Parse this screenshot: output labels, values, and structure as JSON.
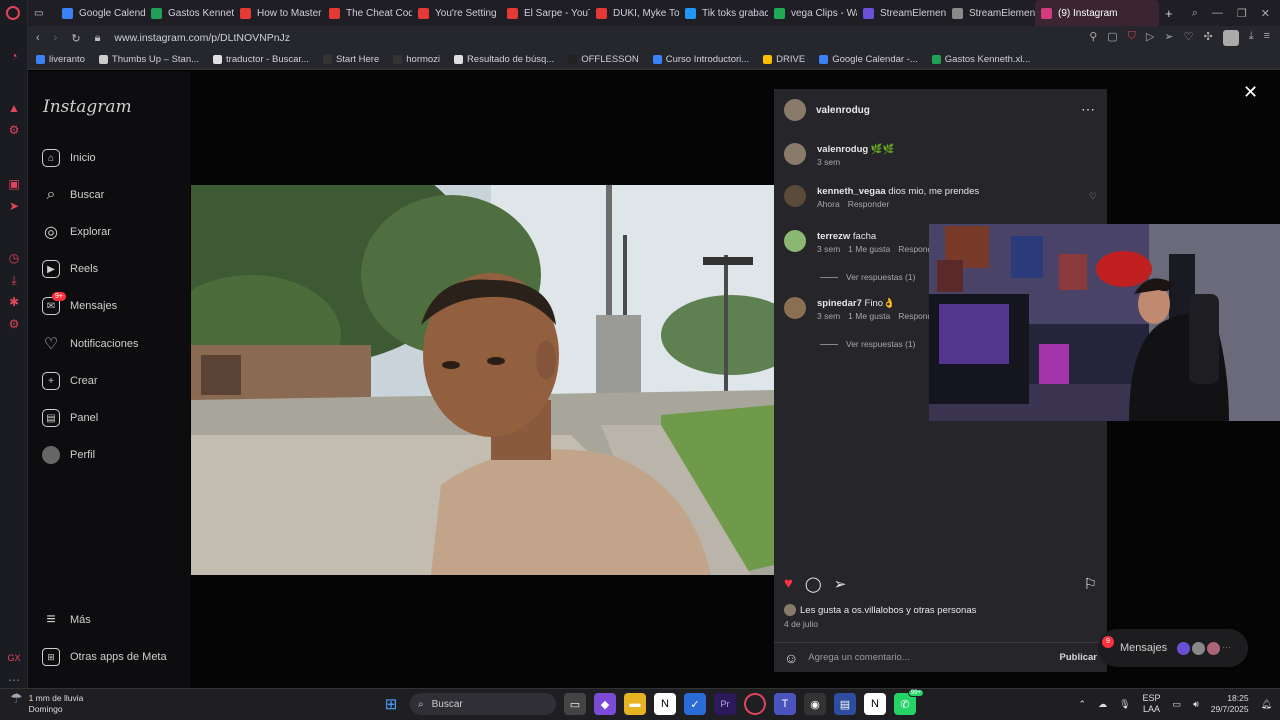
{
  "browser": {
    "tabs": [
      {
        "label": "Google Calenda",
        "color": "#3b82f6"
      },
      {
        "label": "Gastos Kenneth",
        "color": "#22a05a"
      },
      {
        "label": "How to Master",
        "color": "#e53935"
      },
      {
        "label": "The Cheat Cod",
        "color": "#e53935"
      },
      {
        "label": "You're Setting",
        "color": "#e53935"
      },
      {
        "label": "El Sarpe - YouT",
        "color": "#e53935"
      },
      {
        "label": "DUKI, Myke To",
        "color": "#e53935"
      },
      {
        "label": "Tik toks grabac",
        "color": "#2196f3"
      },
      {
        "label": "vega Clips - Wa",
        "color": "#1faa55"
      },
      {
        "label": "StreamElement",
        "color": "#6b4fd6"
      },
      {
        "label": "StreamElement",
        "color": "#8a8a8a"
      }
    ],
    "active_tab": {
      "label": "(9) Instagram",
      "color": "#d13d7a"
    },
    "new_tab": "+",
    "url": "www.instagram.com/p/DLtNOVNPnJz",
    "bookmarks": [
      {
        "label": "liveranto",
        "color": "#3b82f6"
      },
      {
        "label": "Thumbs Up – Stan...",
        "color": "#cccccc"
      },
      {
        "label": "traductor - Buscar...",
        "color": "#e0e0e0"
      },
      {
        "label": "Start Here",
        "color": "#333333"
      },
      {
        "label": "hormozi",
        "color": "#333333"
      },
      {
        "label": "Resultado de búsq...",
        "color": "#e0e0e0"
      },
      {
        "label": "OFFLESSON",
        "color": "#222222"
      },
      {
        "label": "Curso Introductori...",
        "color": "#3b82f6"
      },
      {
        "label": "DRIVE",
        "color": "#fbbc04"
      },
      {
        "label": "Google Calendar -...",
        "color": "#3b82f6"
      },
      {
        "label": "Gastos Kenneth.xl...",
        "color": "#22a05a"
      }
    ]
  },
  "instagram": {
    "logo": "Instagram",
    "nav": [
      {
        "label": "Inicio",
        "icon": "home-icon",
        "glyph": "⌂"
      },
      {
        "label": "Buscar",
        "icon": "search-icon",
        "glyph": "⌕"
      },
      {
        "label": "Explorar",
        "icon": "compass-icon",
        "glyph": "◎"
      },
      {
        "label": "Reels",
        "icon": "reels-icon",
        "glyph": "▶"
      },
      {
        "label": "Mensajes",
        "icon": "messenger-icon",
        "glyph": "✉"
      },
      {
        "label": "Notificaciones",
        "icon": "heart-icon",
        "glyph": "♡"
      },
      {
        "label": "Crear",
        "icon": "plus-icon",
        "glyph": "+"
      },
      {
        "label": "Panel",
        "icon": "chart-icon",
        "glyph": "▤"
      },
      {
        "label": "Perfil",
        "icon": "profile-avatar",
        "glyph": "●"
      }
    ],
    "messages_badge": "9+",
    "more": "Más",
    "meta_apps": "Otras apps de Meta",
    "post": {
      "author": "valenrodug",
      "caption_user": "valenrodug",
      "caption_text": "🌿🌿",
      "caption_time": "3 sem",
      "comments": [
        {
          "user": "kenneth_vegaa",
          "text": "dios mio, me prendes",
          "time": "Ahora",
          "likes": "",
          "reply": "Responder",
          "replies": ""
        },
        {
          "user": "terrezw",
          "text": "facha",
          "time": "3 sem",
          "likes": "1 Me gusta",
          "reply": "Responder",
          "replies": "Ver respuestas (1)"
        },
        {
          "user": "spinedar7",
          "text": "Fino👌",
          "time": "3 sem",
          "likes": "1 Me gusta",
          "reply": "Responder",
          "replies": "Ver respuestas (1)"
        }
      ],
      "liked_by": "Les gusta a os.villalobos y otras personas",
      "date": "4 de julio",
      "comment_placeholder": "Agrega un comentario...",
      "publish": "Publicar"
    },
    "messages_pill": "Mensajes",
    "messages_pill_badge": "9"
  },
  "taskbar": {
    "weather_line1": "1 mm de lluvia",
    "weather_line2": "Domingo",
    "search": "Buscar",
    "lang1": "ESP",
    "lang2": "LAA",
    "time": "18:25",
    "date": "29/7/2025",
    "whatsapp_badge": "99+"
  },
  "colors": {
    "like_red": "#ff3040",
    "accent": "#d13d7a"
  }
}
